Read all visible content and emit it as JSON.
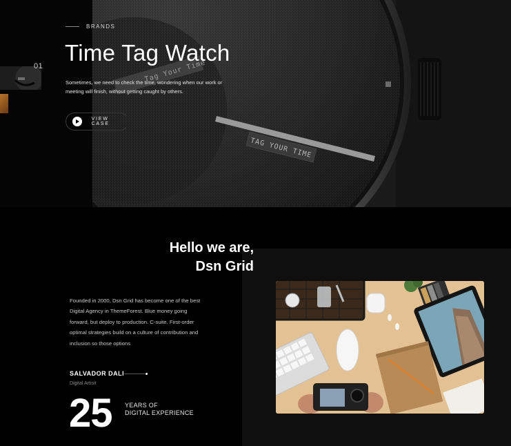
{
  "hero": {
    "eyebrow": "BRANDS",
    "title": "Time Tag Watch",
    "description": "Sometimes, we need to check the time, wondering when our work or meeting will finish, without getting caught by others.",
    "cta_label": "VIEW CASE",
    "slide_number": "01",
    "watch_tag_top": "Tag Your Time",
    "watch_tag_bottom": "TAG YOUR TIME"
  },
  "about": {
    "title_line1": "Hello we are,",
    "title_line2": "Dsn Grid",
    "description": "Founded in 2000, Dsn Grid has become one of the best Digital Agency in ThemeForest. Blue money going forward, but deploy to production. C-suite. First-order optimal strategies build on a culture of contribution and inclusion so those options",
    "person_name": "SALVADOR DALI",
    "person_role": "Digital Artisit",
    "years_number": "25",
    "years_line1": "YEARS OF",
    "years_line2": "DIGITAL EXPERIENCE"
  },
  "colors": {
    "background": "#000000",
    "panel": "#0f0f0f",
    "text": "#ffffff",
    "muted": "#8a8a8a"
  }
}
